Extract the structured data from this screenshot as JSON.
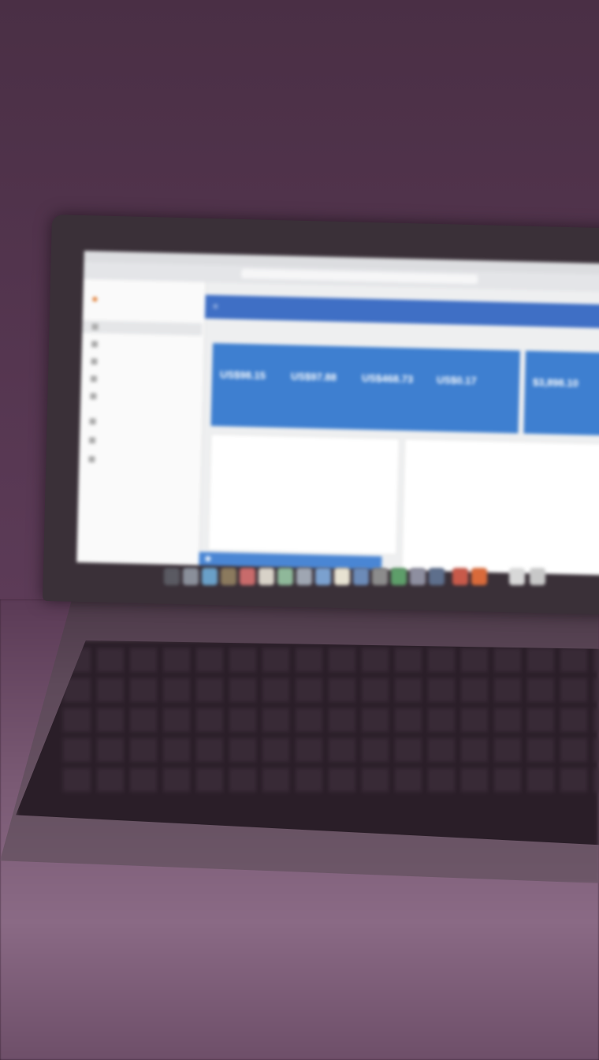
{
  "browser": {
    "url": ""
  },
  "sidebar": {
    "brand": "",
    "items": [
      {
        "label": ""
      },
      {
        "label": ""
      },
      {
        "label": ""
      },
      {
        "label": ""
      },
      {
        "label": ""
      },
      {
        "label": ""
      },
      {
        "label": ""
      },
      {
        "label": ""
      }
    ]
  },
  "appbar": {
    "title": ""
  },
  "summary_card": {
    "title": "",
    "stats": [
      {
        "label": "",
        "value": "US$98.15",
        "sub": ""
      },
      {
        "label": "",
        "value": "US$97.88",
        "sub": ""
      },
      {
        "label": "",
        "value": "US$468.73",
        "sub": ""
      },
      {
        "label": "",
        "value": "US$0.17",
        "sub": ""
      }
    ]
  },
  "side_card": {
    "title": "",
    "value": "$3,898.10"
  },
  "overview_card": {
    "title": "",
    "subtitle": "",
    "cells": [
      {
        "label": "",
        "value": ""
      },
      {
        "label": "",
        "value": ""
      },
      {
        "label": "",
        "value": ""
      },
      {
        "label": "",
        "value": ""
      },
      {
        "label": "",
        "value": ""
      },
      {
        "label": "",
        "value": ""
      }
    ]
  },
  "right_card": {
    "title": "",
    "subtitle": ""
  },
  "colors": {
    "accent": "#3f6fc5",
    "card_blue": "#3e7fd0",
    "background": "#3e2538"
  }
}
